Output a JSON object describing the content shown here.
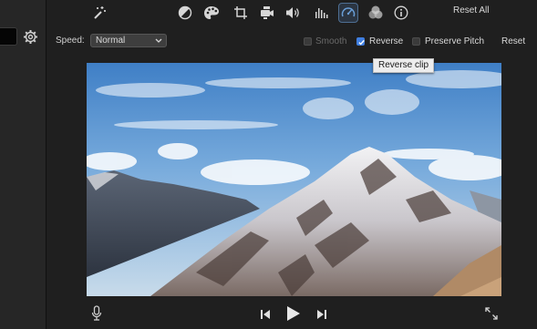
{
  "toolbar": {
    "icons": [
      "magic-wand-icon",
      "color-balance-icon",
      "color-palette-icon",
      "crop-icon",
      "stabilization-camera-icon",
      "volume-icon",
      "equalizer-icon",
      "speed-gauge-icon",
      "noise-filter-icon",
      "info-icon"
    ],
    "active_tool": "speed-gauge-icon",
    "reset_all_label": "Reset All"
  },
  "speed": {
    "label": "Speed:",
    "selected": "Normal",
    "smooth_label": "Smooth",
    "smooth_checked": false,
    "smooth_enabled": false,
    "reverse_label": "Reverse",
    "reverse_checked": true,
    "preserve_pitch_label": "Preserve Pitch",
    "preserve_pitch_checked": false,
    "reset_label": "Reset"
  },
  "tooltip": {
    "text": "Reverse clip"
  },
  "playback": {
    "icons": [
      "microphone-icon",
      "skip-back-icon",
      "play-icon",
      "skip-forward-icon",
      "fullscreen-icon"
    ]
  },
  "colors": {
    "accent": "#3f7ee0",
    "background": "#1f1f1f",
    "panel": "#262626"
  }
}
